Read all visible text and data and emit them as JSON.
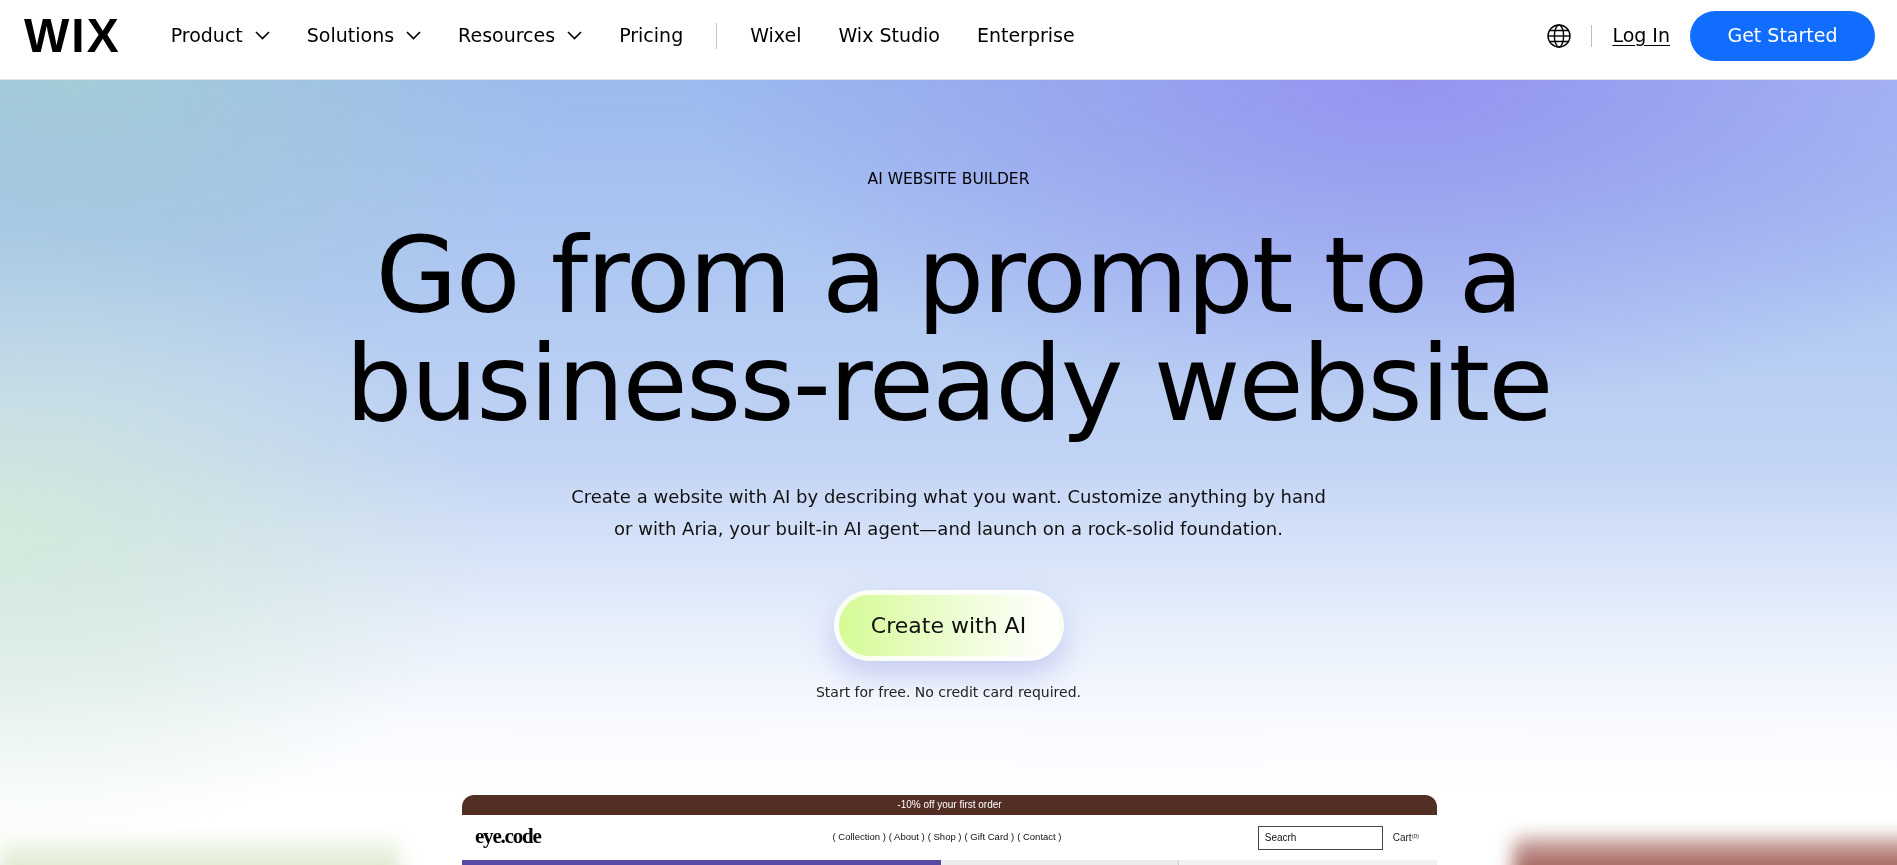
{
  "header": {
    "logo": "WIX",
    "nav_primary": [
      {
        "label": "Product",
        "dropdown": true
      },
      {
        "label": "Solutions",
        "dropdown": true
      },
      {
        "label": "Resources",
        "dropdown": true
      },
      {
        "label": "Pricing",
        "dropdown": false
      }
    ],
    "nav_secondary": [
      {
        "label": "Wixel"
      },
      {
        "label": "Wix Studio"
      },
      {
        "label": "Enterprise"
      }
    ],
    "login": "Log In",
    "cta": "Get Started"
  },
  "hero": {
    "eyebrow": "AI WEBSITE BUILDER",
    "title": "Go from a prompt to a business-ready website",
    "description": "Create a website with AI by describing what you want. Customize anything by hand or with Aria, your built-in AI agent—and launch on a rock-solid foundation.",
    "button": "Create with AI",
    "note": "Start for free. No credit card required."
  },
  "preview": {
    "announcement": "-10% off your first order",
    "logo": "eye.code",
    "menu": [
      "( Collection )",
      "( About )",
      "( Shop )",
      "( Gift Card )",
      "( Contact )"
    ],
    "search": {
      "value": "Seacrh"
    },
    "cart": "Cart$^{(0)}$"
  }
}
